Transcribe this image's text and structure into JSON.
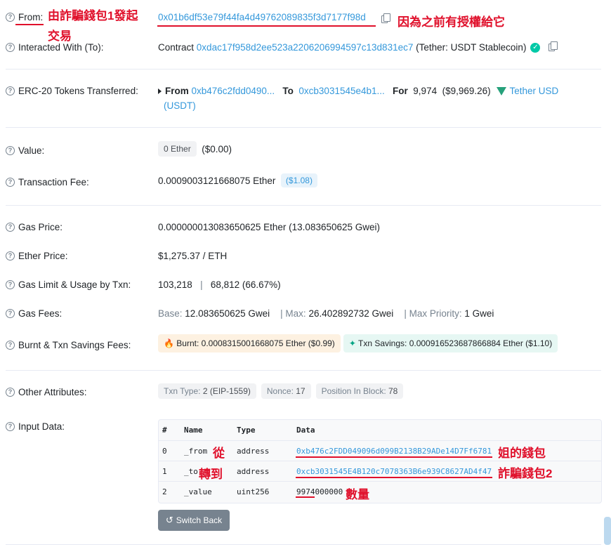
{
  "from": {
    "label": "From:",
    "address": "0x01b6df53e79f44fa4d49762089835f3d7177f98d",
    "annotation_left_1": "由詐騙錢包1發起",
    "annotation_left_2": "交易",
    "annotation_right": "因為之前有授權給它"
  },
  "interacted": {
    "label": "Interacted With (To):",
    "prefix": "Contract",
    "address": "0xdac17f958d2ee523a2206206994597c13d831ec7",
    "name": "(Tether: USDT Stablecoin)"
  },
  "erc20": {
    "label": "ERC-20 Tokens Transferred:",
    "from_kw": "From",
    "from_addr": "0xb476c2fdd0490...",
    "to_kw": "To",
    "to_addr": "0xcb3031545e4b1...",
    "for_kw": "For",
    "amount": "9,974",
    "usd": "($9,969.26)",
    "token_1": "Tether USD",
    "token_2": "(USDT)"
  },
  "value": {
    "label": "Value:",
    "badge": "0 Ether",
    "usd": "($0.00)"
  },
  "fee": {
    "label": "Transaction Fee:",
    "value": "0.0009003121668075 Ether",
    "usd": "($1.08)"
  },
  "gas_price": {
    "label": "Gas Price:",
    "value": "0.000000013083650625 Ether (13.083650625 Gwei)"
  },
  "ether_price": {
    "label": "Ether Price:",
    "value": "$1,275.37 / ETH"
  },
  "gas_limit": {
    "label": "Gas Limit & Usage by Txn:",
    "limit": "103,218",
    "sep": "|",
    "usage": "68,812 (66.67%)"
  },
  "gas_fees": {
    "label": "Gas Fees:",
    "base_label": "Base:",
    "base": "12.083650625 Gwei",
    "max_label": "| Max:",
    "max": "26.402892732 Gwei",
    "prio_label": "| Max Priority:",
    "prio": "1 Gwei"
  },
  "burnt": {
    "label": "Burnt & Txn Savings Fees:",
    "burnt_text": "Burnt: 0.0008315001668075 Ether ($0.99)",
    "savings_text": "Txn Savings: 0.000916523687866884 Ether ($1.10)"
  },
  "other": {
    "label": "Other Attributes:",
    "txn_type_label": "Txn Type:",
    "txn_type": "2 (EIP-1559)",
    "nonce_label": "Nonce:",
    "nonce": "17",
    "pos_label": "Position In Block:",
    "pos": "78"
  },
  "input": {
    "label": "Input Data:",
    "headers": [
      "#",
      "Name",
      "Type",
      "Data"
    ],
    "rows": [
      {
        "idx": "0",
        "name": "_from",
        "type": "address",
        "data": "0xb476c2FDD049096d099B2138B29ADe14D7Ff6781",
        "note_name": "從",
        "note_data": "姐的錢包"
      },
      {
        "idx": "1",
        "name": "_to",
        "type": "address",
        "data": "0xcb3031545E4B120c7078363B6e939C8627AD4f47",
        "note_name": "轉到",
        "note_data": "詐騙錢包2"
      },
      {
        "idx": "2",
        "name": "_value",
        "type": "uint256",
        "data": "9974000000",
        "note_data": "數量"
      }
    ],
    "button": "Switch Back"
  }
}
